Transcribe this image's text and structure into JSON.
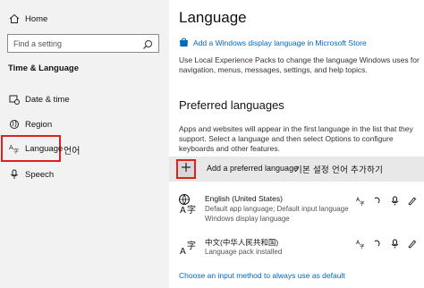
{
  "sidebar": {
    "home_label": "Home",
    "search_placeholder": "Find a setting",
    "section_title": "Time & Language",
    "items": [
      {
        "label": "Date & time"
      },
      {
        "label": "Region"
      },
      {
        "label": "Language"
      },
      {
        "label": "Speech"
      }
    ],
    "annotation_language": "언어"
  },
  "main": {
    "title": "Language",
    "store_link": "Add a Windows display language in Microsoft Store",
    "description": "Use Local Experience Packs to change the language Windows uses for navigation, menus, messages, settings, and help topics.",
    "preferred_title": "Preferred languages",
    "preferred_description": "Apps and websites will appear in the first language in the list that they support. Select a language and then select Options to configure keyboards and other features.",
    "add_label": "Add a preferred language",
    "add_annotation": "기본 설정 언어 추가하기",
    "languages": [
      {
        "name": "English (United States)",
        "details": [
          "Default app language; Default input language",
          "Windows display language"
        ]
      },
      {
        "name": "中文(中华人民共和国)",
        "details": [
          "Language pack installed"
        ]
      }
    ],
    "bottom_link": "Choose an input method to always use as default"
  },
  "colors": {
    "accent": "#0067c0",
    "highlight": "#e02020",
    "sidebar_bg": "#f2f2f2"
  }
}
